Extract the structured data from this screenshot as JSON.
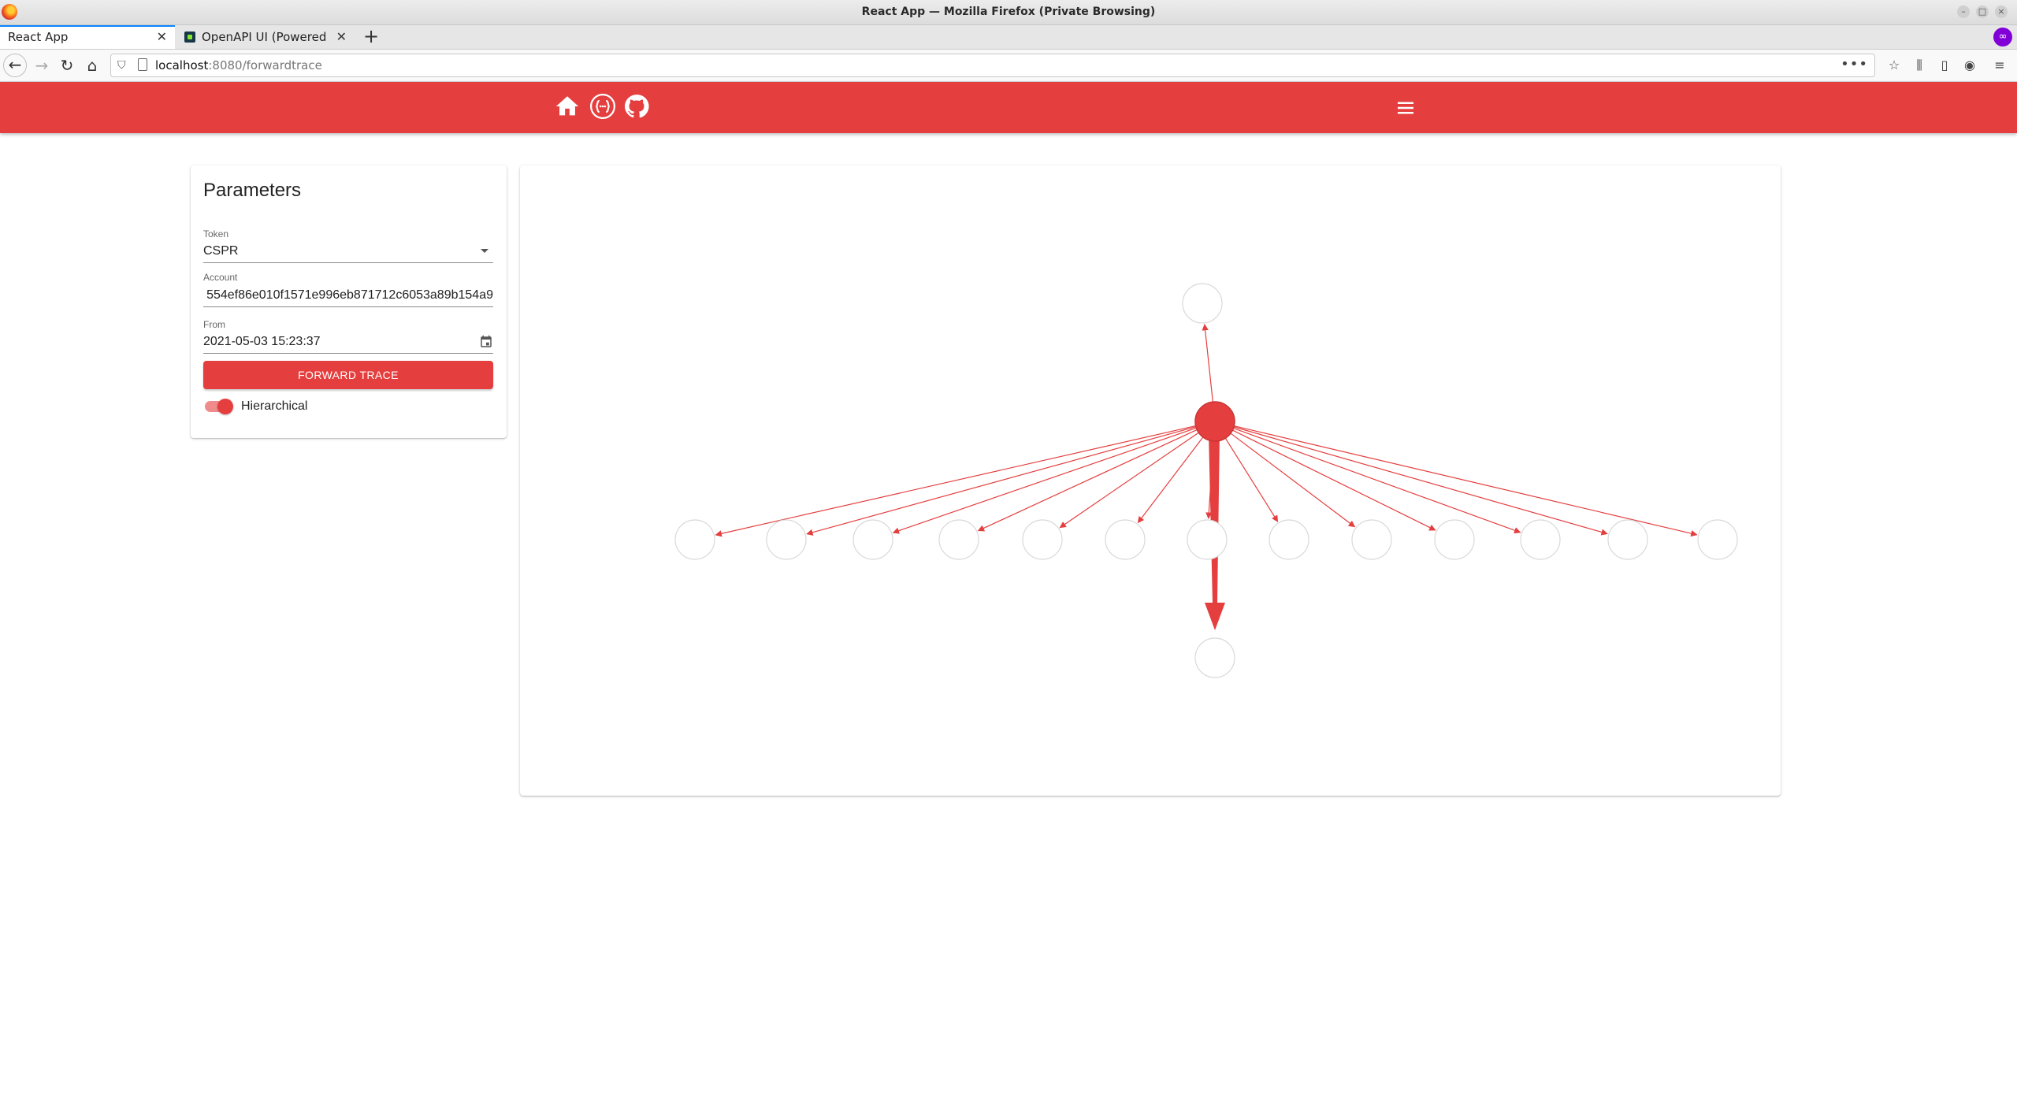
{
  "browser": {
    "window_title": "React App — Mozilla Firefox (Private Browsing)",
    "tabs": [
      {
        "label": "React App",
        "active": true
      },
      {
        "label": "OpenAPI UI (Powered by",
        "active": false
      }
    ],
    "url_host": "localhost",
    "url_path": ":8080/forwardtrace"
  },
  "appbar": {
    "icons": [
      "home-icon",
      "api-icon",
      "github-icon"
    ],
    "menu_icon": "hamburger-menu-icon",
    "color": "#e53e3e"
  },
  "parameters": {
    "title": "Parameters",
    "token_label": "Token",
    "token_value": "CSPR",
    "account_label": "Account",
    "account_value": "554ef86e010f1571e996eb871712c6053a89b154a9",
    "from_label": "From",
    "from_value": "2021-05-03 15:23:37",
    "button_label": "FORWARD TRACE",
    "toggle_label": "Hierarchical",
    "toggle_on": true
  },
  "graph": {
    "root": "center",
    "nodes_per_level": [
      1,
      1,
      13,
      1
    ],
    "edges": [
      {
        "from": "root",
        "to": "top",
        "weight": "thin"
      },
      {
        "from": "root",
        "to": "level1",
        "count": 13,
        "weight": "thin"
      },
      {
        "from": "root",
        "to": "bottom",
        "weight": "heavy"
      }
    ]
  }
}
